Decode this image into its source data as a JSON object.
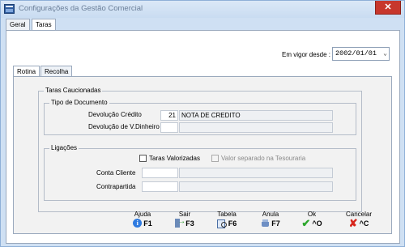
{
  "window": {
    "title": "Configurações da Gestão Comercial",
    "close_label": "✕"
  },
  "tabs": [
    {
      "label": "Geral"
    },
    {
      "label": "Taras"
    }
  ],
  "vigor": {
    "label": "Em vigor desde :",
    "value": "2002/01/01"
  },
  "subtabs": [
    {
      "label": "Rotina"
    },
    {
      "label": "Recolha"
    }
  ],
  "taras_group": {
    "title": "Taras Caucionadas",
    "tipo_group": {
      "title": "Tipo de Documento",
      "rows": [
        {
          "label": "Devolução Crédito",
          "code": "21",
          "description": "NOTA DE CREDITO"
        },
        {
          "label": "Devolução de V.Dinheiro",
          "code": "",
          "description": ""
        }
      ]
    },
    "ligacoes_group": {
      "title": "Ligações",
      "check1_label": "Taras Valorizadas",
      "check2_label": "Valor separado na Tesouraria",
      "rows": [
        {
          "label": "Conta Cliente",
          "code": "",
          "description": ""
        },
        {
          "label": "Contrapartida",
          "code": "",
          "description": ""
        }
      ]
    }
  },
  "buttons": [
    {
      "label": "Ajuda",
      "key": "F1",
      "icon": "info-icon"
    },
    {
      "label": "Sair",
      "key": "F3",
      "icon": "exit-icon"
    },
    {
      "label": "Tabela",
      "key": "F6",
      "icon": "table-search-icon"
    },
    {
      "label": "Anula",
      "key": "F7",
      "icon": "anula-icon"
    },
    {
      "label": "Ok",
      "key": "^O",
      "icon": "checkmark-icon"
    },
    {
      "label": "Cancelar",
      "key": "^C",
      "icon": "cancel-x-icon"
    }
  ],
  "colors": {
    "accent": "#2f7be0",
    "ok": "#2ca62c",
    "cancel": "#d7261c",
    "close": "#c7372c"
  }
}
